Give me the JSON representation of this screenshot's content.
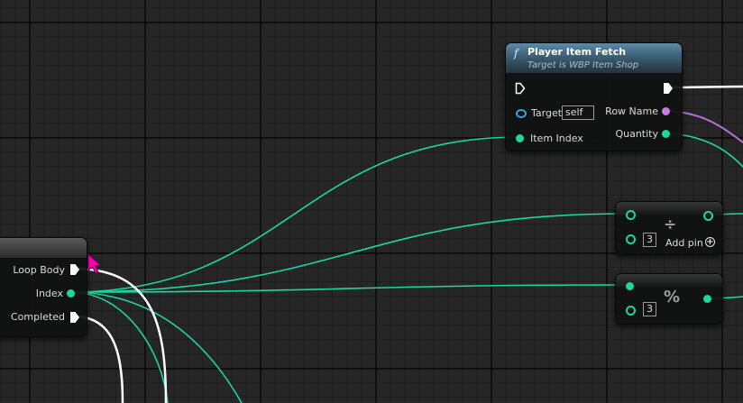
{
  "function_node": {
    "fn_icon": "f",
    "title": "Player Item Fetch",
    "subtitle": "Target is WBP Item Shop",
    "target_label": "Target",
    "target_value": "self",
    "item_index_label": "Item Index",
    "row_name_label": "Row Name",
    "quantity_label": "Quantity"
  },
  "loop_node": {
    "loop_body_label": "Loop Body",
    "index_label": "Index",
    "completed_label": "Completed"
  },
  "divide_node": {
    "symbol": "÷",
    "input_value": "3",
    "add_pin_label": "Add pin",
    "add_pin_icon": "+"
  },
  "modulo_node": {
    "symbol": "%",
    "input_value": "3"
  },
  "colors": {
    "integer_pin": "#1dd6a0",
    "name_pin": "#c77ce8",
    "exec_pin": "#ffffff",
    "object_pin": "#35a6e3",
    "function_header": "#3c5e75",
    "cursor": "#ff00b4"
  }
}
